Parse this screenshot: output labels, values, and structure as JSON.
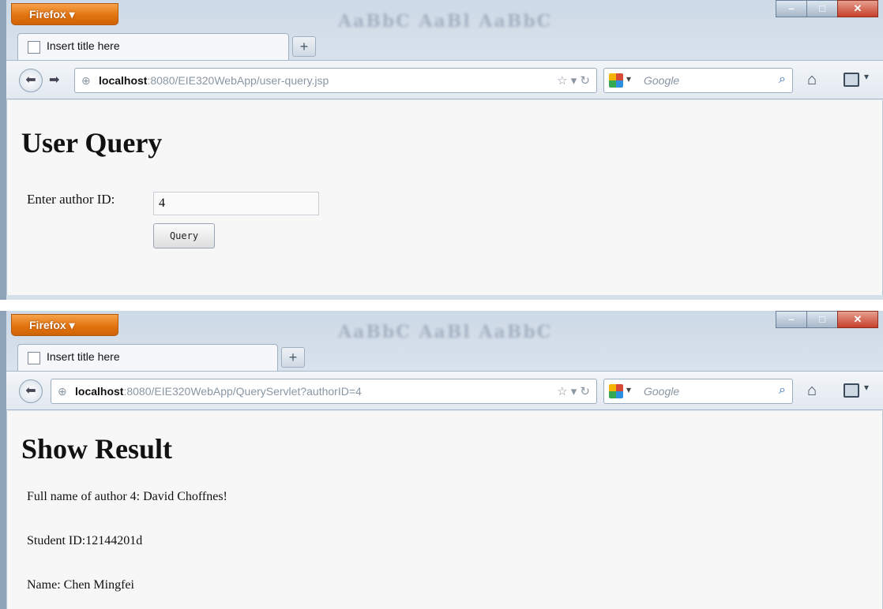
{
  "browser": {
    "menu_button": "Firefox ▾",
    "caption_blur": "AaBbC AaBl AaBbC",
    "tab_title": "Insert title here",
    "new_tab": "+",
    "search_placeholder": "Google",
    "icons": [
      "back-icon",
      "forward-icon",
      "globe-icon",
      "star-icon",
      "reload-icon",
      "google-icon",
      "search-icon",
      "home-icon",
      "bookmarks-icon"
    ]
  },
  "window1": {
    "url_host": "localhost",
    "url_rest": ":8080/EIE320WebApp/user-query.jsp",
    "heading": "User Query",
    "form_label": "Enter author ID:",
    "input_value": "4",
    "button_label": "Query"
  },
  "window2": {
    "url_host": "localhost",
    "url_rest": ":8080/EIE320WebApp/QueryServlet?authorID=4",
    "heading": "Show Result",
    "lines": [
      "Full name of author 4: David Choffnes!",
      "Student ID:12144201d",
      "Name: Chen Mingfei"
    ]
  }
}
